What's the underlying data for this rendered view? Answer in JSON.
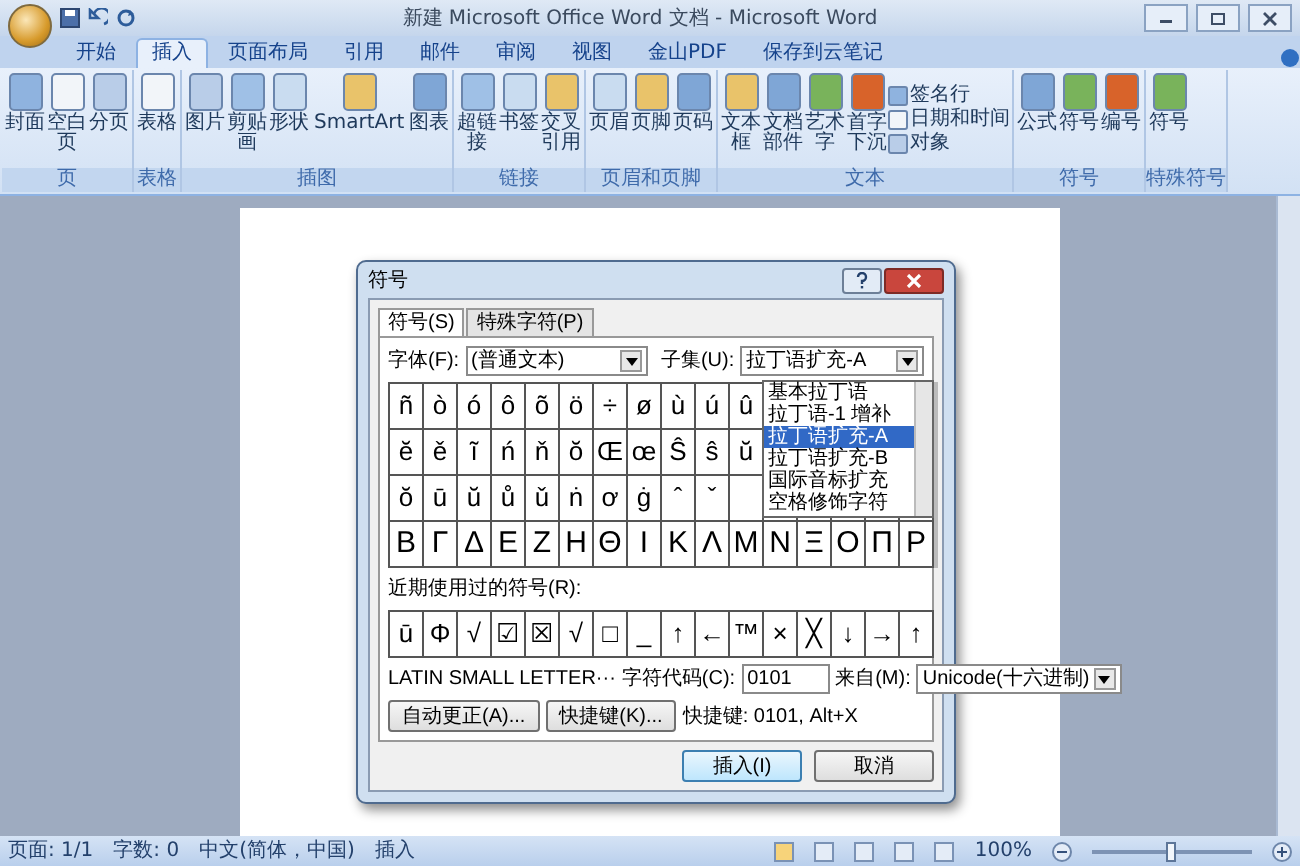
{
  "window": {
    "title": "新建 Microsoft Office Word 文档 - Microsoft Word"
  },
  "tabs": [
    {
      "label": "开始",
      "selected": false
    },
    {
      "label": "插入",
      "selected": true
    },
    {
      "label": "页面布局",
      "selected": false
    },
    {
      "label": "引用",
      "selected": false
    },
    {
      "label": "邮件",
      "selected": false
    },
    {
      "label": "审阅",
      "selected": false
    },
    {
      "label": "视图",
      "selected": false
    },
    {
      "label": "金山PDF",
      "selected": false
    },
    {
      "label": "保存到云笔记",
      "selected": false
    }
  ],
  "ribbon": {
    "groups": [
      {
        "label": "页",
        "items": [
          {
            "label": "封面",
            "kind": "large"
          },
          {
            "label": "空白页",
            "kind": "large"
          },
          {
            "label": "分页",
            "kind": "large"
          }
        ]
      },
      {
        "label": "表格",
        "items": [
          {
            "label": "表格",
            "kind": "large"
          }
        ]
      },
      {
        "label": "插图",
        "items": [
          {
            "label": "图片",
            "kind": "large"
          },
          {
            "label": "剪贴画",
            "kind": "large"
          },
          {
            "label": "形状",
            "kind": "large"
          },
          {
            "label": "SmartArt",
            "kind": "large"
          },
          {
            "label": "图表",
            "kind": "large"
          }
        ]
      },
      {
        "label": "链接",
        "items": [
          {
            "label": "超链接",
            "kind": "large"
          },
          {
            "label": "书签",
            "kind": "large"
          },
          {
            "label": "交叉引用",
            "kind": "large"
          }
        ]
      },
      {
        "label": "页眉和页脚",
        "items": [
          {
            "label": "页眉",
            "kind": "large"
          },
          {
            "label": "页脚",
            "kind": "large"
          },
          {
            "label": "页码",
            "kind": "large"
          }
        ]
      },
      {
        "label": "文本",
        "items": [
          {
            "label": "文本框",
            "kind": "large"
          },
          {
            "label": "文档部件",
            "kind": "large"
          },
          {
            "label": "艺术字",
            "kind": "large"
          },
          {
            "label": "首字下沉",
            "kind": "large"
          },
          {
            "label": "签名行",
            "kind": "small"
          },
          {
            "label": "日期和时间",
            "kind": "small"
          },
          {
            "label": "对象",
            "kind": "small"
          }
        ]
      },
      {
        "label": "符号",
        "items": [
          {
            "label": "公式",
            "kind": "large"
          },
          {
            "label": "符号",
            "kind": "large"
          },
          {
            "label": "编号",
            "kind": "large"
          }
        ]
      },
      {
        "label": "特殊符号",
        "items": [
          {
            "label": "符号",
            "kind": "large"
          }
        ]
      }
    ]
  },
  "dialog": {
    "title": "符号",
    "tabs": [
      {
        "label": "符号(S)",
        "selected": true
      },
      {
        "label": "特殊字符(P)",
        "selected": false
      }
    ],
    "font_label": "字体(F):",
    "font_value": "(普通文本)",
    "subset_label": "子集(U):",
    "subset_value": "拉丁语扩充-A",
    "subset_options": [
      {
        "label": "基本拉丁语",
        "selected": false
      },
      {
        "label": "拉丁语-1 增补",
        "selected": false
      },
      {
        "label": "拉丁语扩充-A",
        "selected": true
      },
      {
        "label": "拉丁语扩充-B",
        "selected": false
      },
      {
        "label": "国际音标扩充",
        "selected": false
      },
      {
        "label": "空格修饰字符",
        "selected": false
      }
    ],
    "grid_rows": [
      [
        "ñ",
        "ò",
        "ó",
        "ô",
        "õ",
        "ö",
        "÷",
        "ø",
        "ù",
        "ú",
        "û"
      ],
      [
        "ĕ",
        "ě",
        "ĩ",
        "ń",
        "ň",
        "ŏ",
        "Œ",
        "œ",
        "Ŝ",
        "ŝ",
        "ŭ"
      ],
      [
        "ŏ",
        "ū",
        "ŭ",
        "ů",
        "ǔ",
        "ṅ",
        "ơ",
        "ġ",
        "ˆ",
        "ˇ"
      ],
      [
        "Β",
        "Γ",
        "Δ",
        "Ε",
        "Ζ",
        "Η",
        "Θ",
        "Ι",
        "Κ",
        "Λ",
        "Μ",
        "Ν",
        "Ξ",
        "Ο",
        "Π",
        "Ρ"
      ]
    ],
    "recent_label": "近期使用过的符号(R):",
    "recent": [
      "ū",
      "Φ",
      "√",
      "☑",
      "☒",
      "√",
      "□",
      "_",
      "↑",
      "←",
      "™",
      "×",
      "╳",
      "↓",
      "→",
      "↑"
    ],
    "char_name": "LATIN SMALL LETTER···",
    "code_label": "字符代码(C):",
    "code_value": "0101",
    "from_label": "来自(M):",
    "from_value": "Unicode(十六进制)",
    "autocorrect_button": "自动更正(A)...",
    "shortcut_button": "快捷键(K)...",
    "shortcut_text": "快捷键: 0101, Alt+X",
    "insert_button": "插入(I)",
    "cancel_button": "取消"
  },
  "status_bar": {
    "items": [
      "页面: 1/1",
      "字数: 0",
      "中文(简体，中国)",
      "插入"
    ],
    "zoom": "100%",
    "zoom_slider": {
      "level": 0.5
    }
  }
}
